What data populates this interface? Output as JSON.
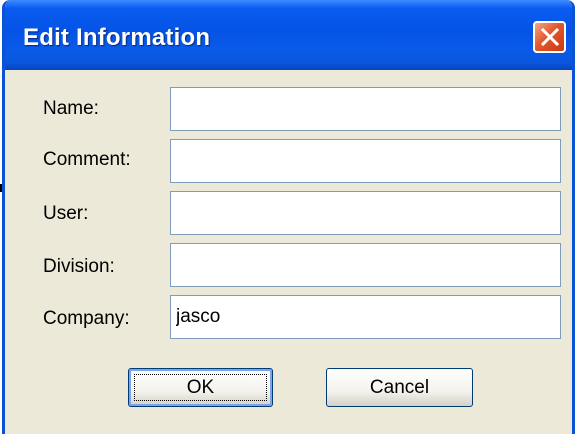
{
  "window": {
    "title": "Edit Information",
    "close_icon": "close-icon"
  },
  "fields": [
    {
      "label": "Name:",
      "value": ""
    },
    {
      "label": "Comment:",
      "value": ""
    },
    {
      "label": "User:",
      "value": ""
    },
    {
      "label": "Division:",
      "value": ""
    },
    {
      "label": "Company:",
      "value": "jasco"
    }
  ],
  "buttons": {
    "ok_label": "OK",
    "cancel_label": "Cancel"
  },
  "colors": {
    "titlebar": "#0553e6",
    "close_button": "#e3572b",
    "dialog_bg": "#ece9d8",
    "input_border": "#7f9db9"
  }
}
